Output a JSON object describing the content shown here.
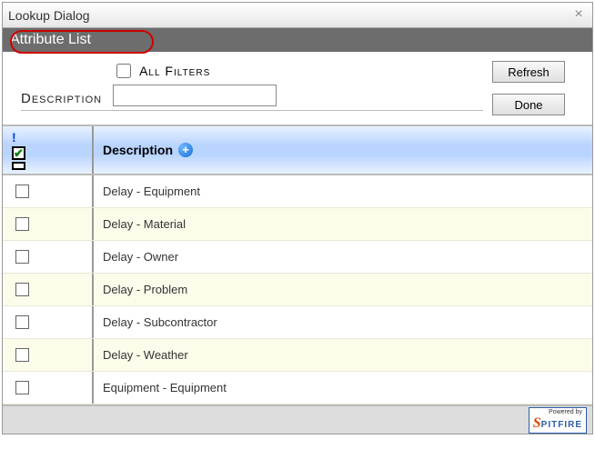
{
  "dialog": {
    "title": "Lookup Dialog",
    "subtitle": "Attribute List",
    "close_label": "×"
  },
  "filter": {
    "description_label": "Description",
    "all_filters_label": "All Filters",
    "all_filters_checked": false,
    "description_value": ""
  },
  "buttons": {
    "refresh": "Refresh",
    "done": "Done"
  },
  "grid": {
    "header": {
      "excl": "!",
      "description": "Description"
    },
    "rows": [
      {
        "selected": false,
        "desc": "Delay - Equipment"
      },
      {
        "selected": false,
        "desc": "Delay - Material"
      },
      {
        "selected": false,
        "desc": "Delay - Owner"
      },
      {
        "selected": false,
        "desc": "Delay - Problem"
      },
      {
        "selected": false,
        "desc": "Delay - Subcontractor"
      },
      {
        "selected": false,
        "desc": "Delay - Weather"
      },
      {
        "selected": false,
        "desc": "Equipment - Equipment"
      }
    ]
  },
  "footer": {
    "powered_by": "Powered by",
    "brand_s": "S",
    "brand_rest": "PITFIRE"
  }
}
